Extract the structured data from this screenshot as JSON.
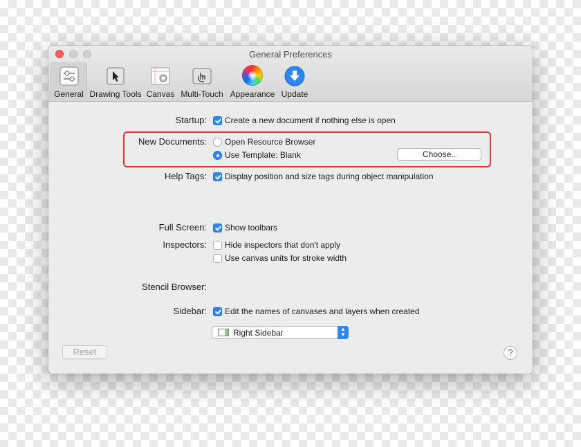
{
  "window": {
    "title": "General Preferences"
  },
  "toolbar": {
    "items": [
      {
        "label": "General",
        "icon": "sliders-icon",
        "selected": true
      },
      {
        "label": "Drawing Tools",
        "icon": "pointer-icon",
        "selected": false
      },
      {
        "label": "Canvas",
        "icon": "canvas-icon",
        "selected": false
      },
      {
        "label": "Multi-Touch",
        "icon": "touch-icon",
        "selected": false
      },
      {
        "label": "Appearance",
        "icon": "color-wheel-icon",
        "selected": false
      },
      {
        "label": "Update",
        "icon": "download-arrow-icon",
        "selected": false
      }
    ]
  },
  "startup": {
    "label": "Startup:",
    "option": "Create a new document if nothing else is open",
    "checked": true
  },
  "new_documents": {
    "label": "New Documents:",
    "option_browser": "Open Resource Browser",
    "option_template": "Use Template: Blank",
    "selected": "template",
    "choose_label": "Choose.."
  },
  "help_tags": {
    "label": "Help Tags:",
    "option": "Display position and size tags during object manipulation",
    "checked": true
  },
  "full_screen": {
    "label": "Full Screen:",
    "option": "Show toolbars",
    "checked": true
  },
  "inspectors": {
    "label": "Inspectors:",
    "option_hide": "Hide inspectors that don't apply",
    "option_units": "Use canvas units for stroke width",
    "hide_checked": false,
    "units_checked": false
  },
  "stencil_browser": {
    "label": "Stencil Browser:",
    "value": "Right Sidebar"
  },
  "sidebar": {
    "label": "Sidebar:",
    "option": "Edit the names of canvases and layers when created",
    "checked": true
  },
  "footer": {
    "reset_label": "Reset",
    "help_label": "?"
  },
  "colors": {
    "accent": "#2f86ee",
    "highlight": "#e8312a"
  }
}
